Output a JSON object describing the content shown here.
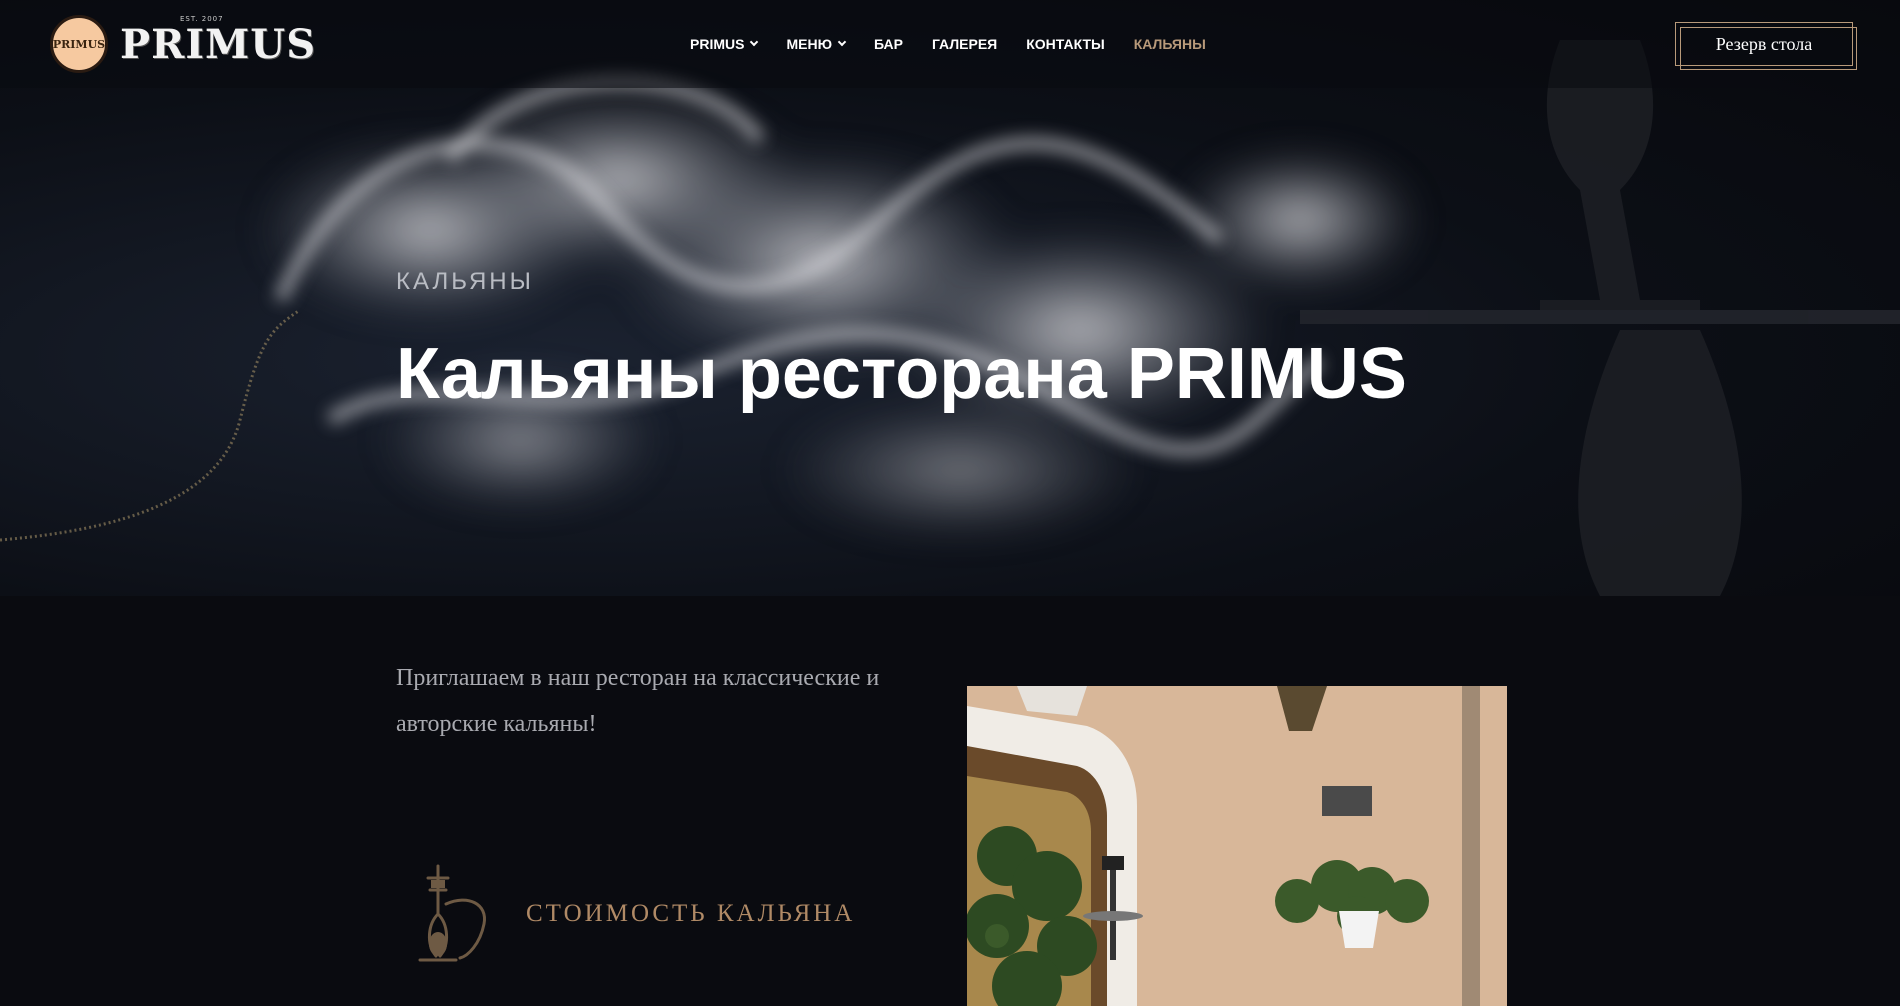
{
  "header": {
    "logo": {
      "name": "PRIMUS",
      "est": "EST. 2007",
      "badge": "PRIMUS"
    },
    "nav": [
      {
        "label": "PRIMUS",
        "dropdown": true,
        "active": false
      },
      {
        "label": "МЕНЮ",
        "dropdown": true,
        "active": false
      },
      {
        "label": "БАР",
        "dropdown": false,
        "active": false
      },
      {
        "label": "ГАЛЕРЕЯ",
        "dropdown": false,
        "active": false
      },
      {
        "label": "КОНТАКТЫ",
        "dropdown": false,
        "active": false
      },
      {
        "label": "КАЛЬЯНЫ",
        "dropdown": false,
        "active": true
      }
    ],
    "reserve_label": "Резерв стола"
  },
  "hero": {
    "label": "КАЛЬЯНЫ",
    "title": "Кальяны ресторана PRIMUS"
  },
  "content": {
    "intro": "Приглашаем в наш ресторан на классические и авторские кальяны!",
    "price_label": "СТОИМОСТЬ КАЛЬЯНА",
    "price_icon": "hookah-icon"
  },
  "colors": {
    "background": "#0a0b10",
    "accent": "#b89a7a",
    "accent_dark": "#b08a66",
    "text_muted": "#a9aab0"
  }
}
